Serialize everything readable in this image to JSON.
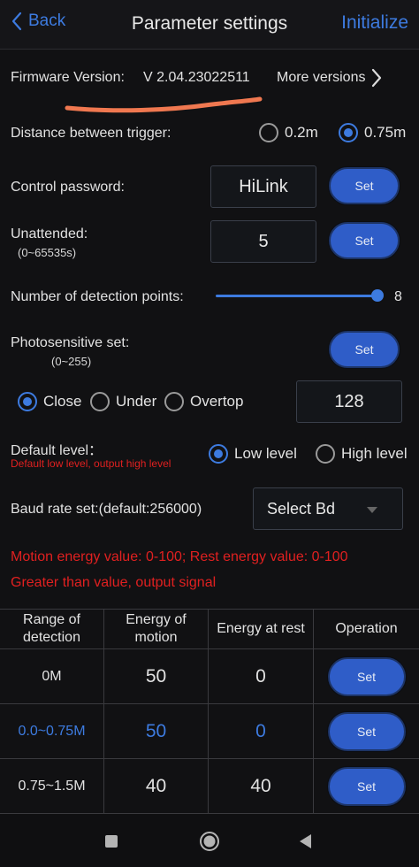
{
  "header": {
    "back_label": "Back",
    "title": "Parameter settings",
    "initialize_label": "Initialize"
  },
  "firmware": {
    "label": "Firmware Version:",
    "value": "V 2.04.23022511",
    "more_label": "More versions"
  },
  "trigger": {
    "label": "Distance between trigger:",
    "options": [
      "0.2m",
      "0.75m"
    ],
    "selected": "0.75m"
  },
  "password": {
    "label": "Control password:",
    "value": "HiLink",
    "set_label": "Set"
  },
  "unattended": {
    "label": "Unattended:",
    "range": "(0~65535s)",
    "value": "5",
    "set_label": "Set"
  },
  "detection_points": {
    "label": "Number of detection points:",
    "value": "8"
  },
  "photosensitive": {
    "label": "Photosensitive set:",
    "range": "(0~255)",
    "set_label": "Set",
    "options": [
      "Close",
      "Under",
      "Overtop"
    ],
    "selected": "Close",
    "value": "128"
  },
  "default_level": {
    "label": "Default level：",
    "note": "Default low level, output high level",
    "options": [
      "Low level",
      "High level"
    ],
    "selected": "Low level"
  },
  "baud": {
    "label": "Baud rate set:(default:256000)",
    "select_label": "Select Bd"
  },
  "notes": {
    "line1": "Motion energy value: 0-100; Rest energy value: 0-100",
    "line2": "Greater than value, output signal"
  },
  "table": {
    "headers": [
      "Range of detection",
      "Energy of motion",
      "Energy at rest",
      "Operation"
    ],
    "rows": [
      {
        "range": "0M",
        "motion": "50",
        "rest": "0",
        "op": "Set"
      },
      {
        "range": "0.0~0.75M",
        "motion": "50",
        "rest": "0",
        "op": "Set"
      },
      {
        "range": "0.75~1.5M",
        "motion": "40",
        "rest": "40",
        "op": "Set"
      }
    ]
  },
  "colors": {
    "accent": "#3d7be0",
    "alert": "#e02020",
    "annotation": "#f07850",
    "button": "#2f5dc8",
    "background": "#111113"
  }
}
